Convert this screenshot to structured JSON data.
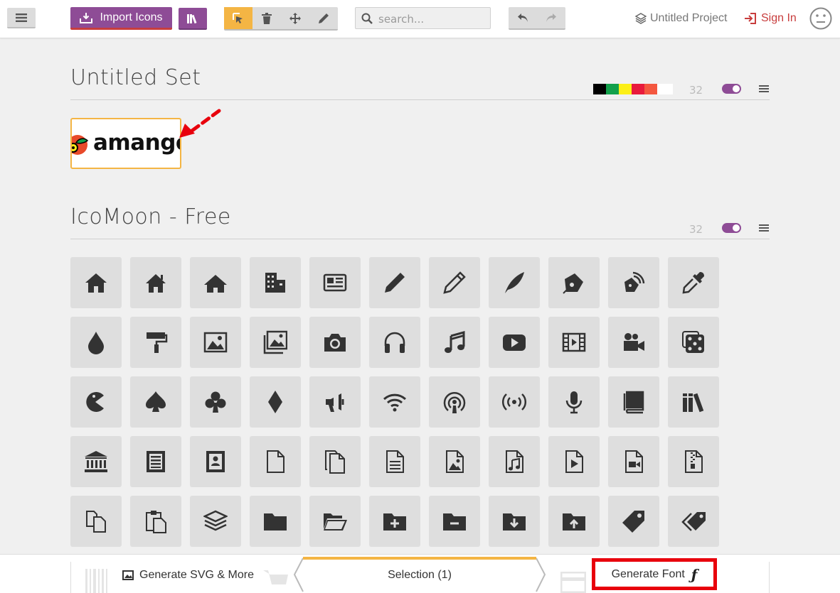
{
  "toolbar": {
    "import_label": "Import Icons",
    "search_placeholder": "search...",
    "project_label": "Untitled Project",
    "signin_label": "Sign In"
  },
  "sets": [
    {
      "title": "Untitled Set",
      "count": "32",
      "swatches": [
        "#000000",
        "#12a04b",
        "#fcef17",
        "#e81a3c",
        "#f4573f",
        "#ffffff"
      ]
    },
    {
      "title": "IcoMoon - Free",
      "count": "32"
    }
  ],
  "custom_icon": {
    "logo_text": "amango"
  },
  "icon_rows": [
    [
      "home-icon",
      "home2-icon",
      "home3-icon",
      "office-icon",
      "newspaper-icon",
      "pencil-icon",
      "pencil2-icon",
      "quill-icon",
      "pen-icon",
      "blog-icon",
      "eyedropper-icon"
    ],
    [
      "droplet-icon",
      "paint-format-icon",
      "image-icon",
      "images-icon",
      "camera-icon",
      "headphones-icon",
      "music-icon",
      "play-icon",
      "film-icon",
      "video-camera-icon",
      "dice-icon"
    ],
    [
      "pacman-icon",
      "spades-icon",
      "clubs-icon",
      "diamonds-icon",
      "bullhorn-icon",
      "connection-icon",
      "podcast-icon",
      "feed-icon",
      "mic-icon",
      "book-icon",
      "books-icon"
    ],
    [
      "library-icon",
      "file-text-icon",
      "profile-icon",
      "file-empty-icon",
      "files-empty-icon",
      "file-text2-icon",
      "file-picture-icon",
      "file-music-icon",
      "file-play-icon",
      "file-video-icon",
      "file-zip-icon"
    ],
    [
      "copy-icon",
      "paste-icon",
      "stack-icon",
      "folder-icon",
      "folder-open-icon",
      "folder-plus-icon",
      "folder-minus-icon",
      "folder-download-icon",
      "folder-upload-icon",
      "price-tag-icon",
      "price-tags-icon"
    ]
  ],
  "bottombar": {
    "svg_label": "Generate SVG & More",
    "selection_label": "Selection (1)",
    "font_label": "Generate Font",
    "font_glyph": "ƒ"
  },
  "colors": {
    "accent_purple": "#8e4c96",
    "accent_orange": "#f4b544",
    "signin_red": "#c83d3d",
    "highlight_red": "#e8000c"
  }
}
